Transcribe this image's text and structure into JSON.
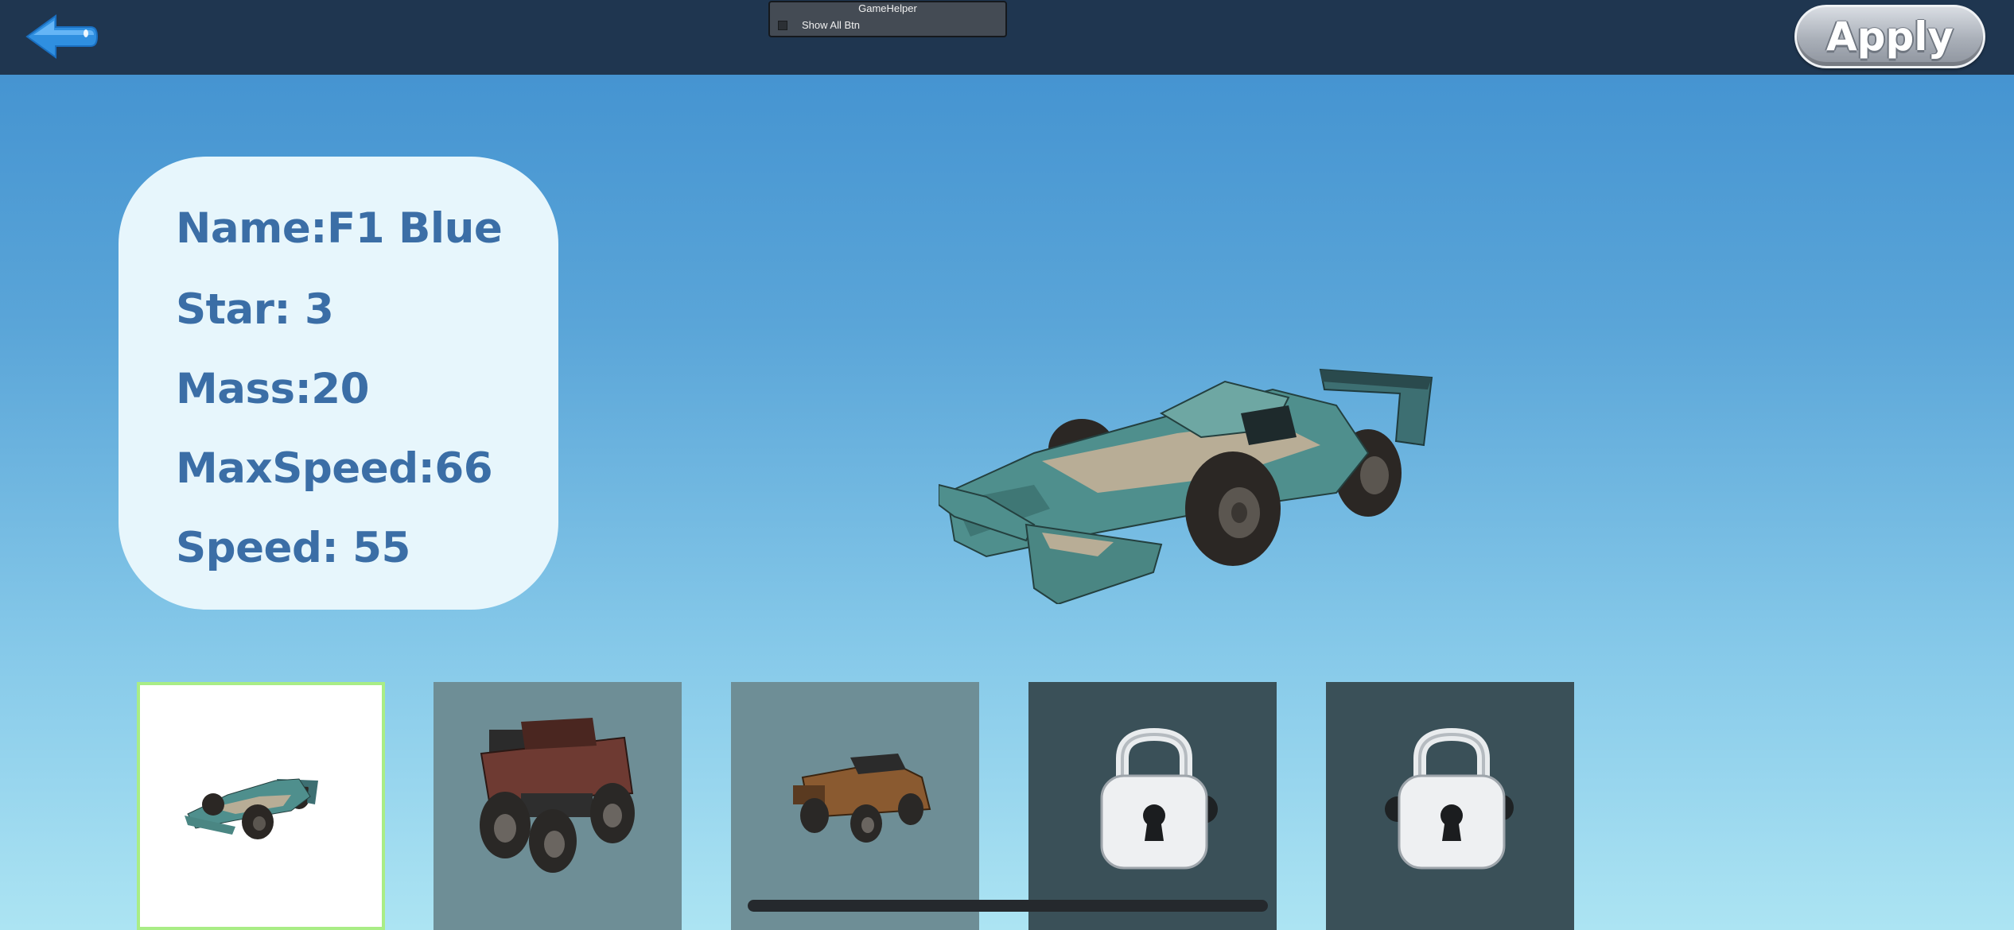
{
  "header": {
    "back_icon": "back-arrow-icon",
    "apply_label": "Apply"
  },
  "game_helper": {
    "title": "GameHelper",
    "checkbox_label": "Show All Btn",
    "checked": false
  },
  "car_info": {
    "name": "Name:F1 Blue",
    "star": "Star: 3",
    "mass": "Mass:20",
    "max_speed": "MaxSpeed:66",
    "speed": "Speed: 55"
  },
  "car_slots": [
    {
      "model": "f1-car",
      "selected": true,
      "locked": false
    },
    {
      "model": "monster-truck",
      "selected": false,
      "locked": false
    },
    {
      "model": "pickup-truck",
      "selected": false,
      "locked": false
    },
    {
      "model": "locked-car",
      "selected": false,
      "locked": true
    },
    {
      "model": "locked-car",
      "selected": false,
      "locked": true
    }
  ],
  "colors": {
    "topbar": "#1f3650",
    "stat_text": "#3b6ea6",
    "info_card": "#e7f6fc",
    "selected_border": "#a9ed86",
    "f1_body": "#4a8c8a"
  }
}
